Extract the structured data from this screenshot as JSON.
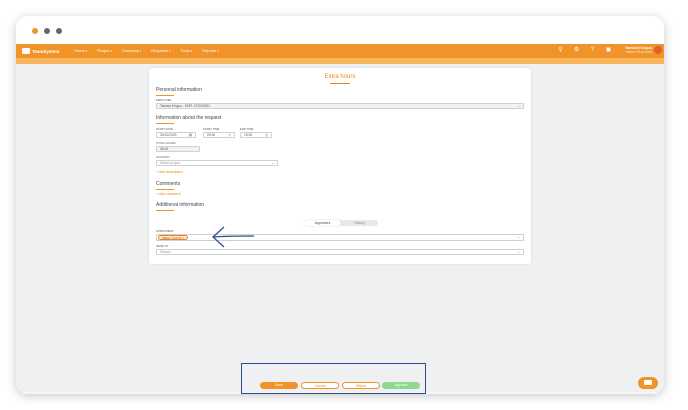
{
  "brand": {
    "name": "TeamSystem",
    "accent": "#f0942a"
  },
  "nav": {
    "items": [
      "Home",
      "People",
      "Company",
      "Requests",
      "Tools",
      "Reports"
    ],
    "user_name": "Tamara Kingus",
    "user_sub": "Human Resources"
  },
  "subbar": {
    "label": "Pending"
  },
  "form": {
    "title": "Extra hours",
    "personal": {
      "title": "Personal information",
      "employee_label": "Employee",
      "employee_value": "Tamara Kingus - ENR: 472000001"
    },
    "request": {
      "title": "Information about the request",
      "start_date_label": "Start date",
      "start_date_value": "30/10/2023",
      "start_time_label": "Start time",
      "start_time_value": "09:00",
      "end_time_label": "End time",
      "end_time_value": "15:00",
      "total_hours_label": "Total hours",
      "total_hours_value": "06:00",
      "account_label": "Account",
      "account_placeholder": "Select project",
      "add_description": "Add description"
    },
    "comments": {
      "title": "Comments",
      "add_comment": "Add comment"
    },
    "additional": {
      "title": "Additional information",
      "toggle": [
        "Approvers",
        "History"
      ],
      "approvers_label": "Approvers",
      "approver_tag": "Marco Guerra",
      "send_to_label": "Send to",
      "send_to_placeholder": "Search"
    }
  },
  "actions": {
    "save": "Save",
    "cancel": "Cancel",
    "reject": "Reject",
    "approve": "Approve"
  }
}
